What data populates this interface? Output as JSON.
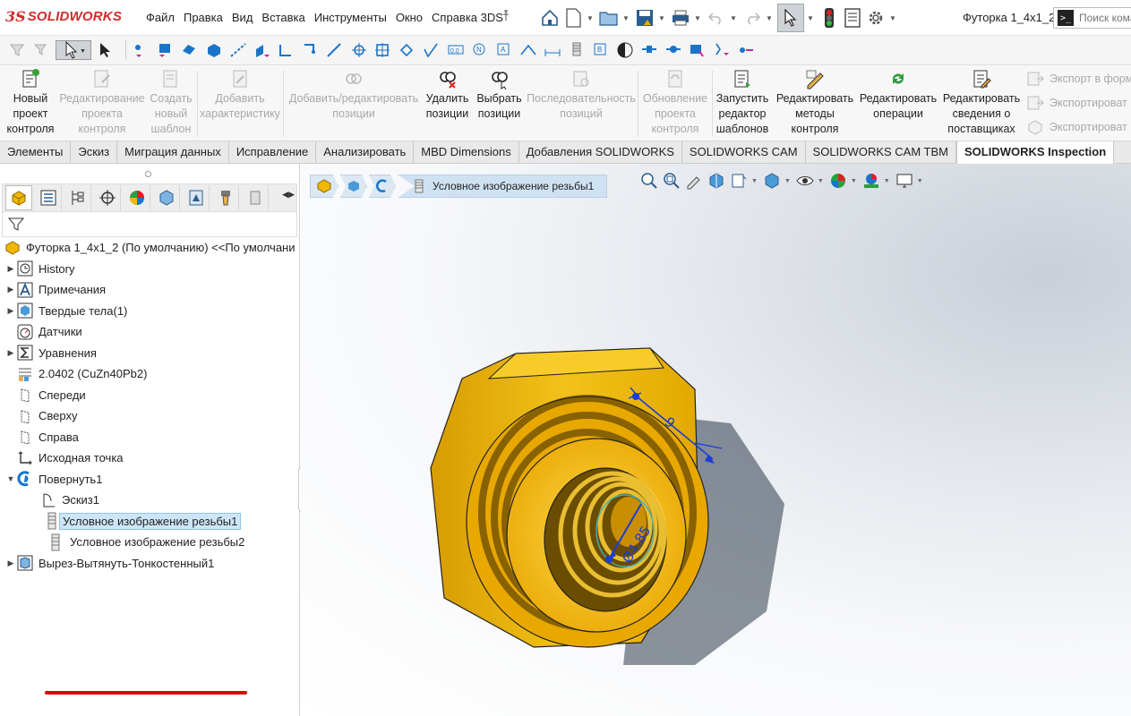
{
  "app": {
    "brand_mark": "3S",
    "brand_name": "SOLIDWORKS",
    "menu": [
      "Файл",
      "Правка",
      "Вид",
      "Вставка",
      "Инструменты",
      "Окно",
      "Справка 3DS"
    ],
    "document_title": "Футорка 1_4x1_2",
    "search_placeholder": "Поиск кома"
  },
  "commands": [
    {
      "label": "Новый\nпроект\nконтроля",
      "enabled": true
    },
    {
      "label": "Редактирование\nпроекта\nконтроля",
      "enabled": false
    },
    {
      "label": "Создать\nновый\nшаблон",
      "enabled": false
    },
    {
      "label": "Добавить\nхарактеристику",
      "enabled": false
    },
    {
      "label": "Добавить/редактировать\nпозиции",
      "enabled": false
    },
    {
      "label": "Удалить\nпозиции",
      "enabled": true
    },
    {
      "label": "Выбрать\nпозиции",
      "enabled": true
    },
    {
      "label": "Последовательность\nпозиций",
      "enabled": false
    },
    {
      "label": "Обновление\nпроекта\nконтроля",
      "enabled": false
    },
    {
      "label": "Запустить\nредактор\nшаблонов",
      "enabled": true
    },
    {
      "label": "Редактировать\nметоды\nконтроля",
      "enabled": true
    },
    {
      "label": "Редактировать\nоперации",
      "enabled": true
    },
    {
      "label": "Редактировать\nсведения о\nпоставщиках",
      "enabled": true
    }
  ],
  "export_items": [
    "Экспорт в форм",
    "Экспортироват",
    "Экспортироват"
  ],
  "tabs": [
    "Элементы",
    "Эскиз",
    "Миграция данных",
    "Исправление",
    "Анализировать",
    "MBD Dimensions",
    "Добавления SOLIDWORKS",
    "SOLIDWORKS CAM",
    "SOLIDWORKS CAM TBM",
    "SOLIDWORKS Inspection"
  ],
  "active_tab": "SOLIDWORKS Inspection",
  "tree": {
    "root": "Футорка 1_4x1_2 (По умолчанию) <<По умолчани",
    "nodes": [
      {
        "label": "History",
        "expander": true,
        "icon": "history-icon"
      },
      {
        "label": "Примечания",
        "expander": true,
        "icon": "annotations-icon"
      },
      {
        "label": "Твердые тела(1)",
        "expander": true,
        "icon": "solid-bodies-icon"
      },
      {
        "label": "Датчики",
        "expander": false,
        "icon": "sensors-icon"
      },
      {
        "label": "Уравнения",
        "expander": true,
        "icon": "equations-icon"
      },
      {
        "label": "2.0402 (CuZn40Pb2)",
        "expander": false,
        "icon": "material-icon"
      },
      {
        "label": "Спереди",
        "expander": false,
        "icon": "plane-icon"
      },
      {
        "label": "Сверху",
        "expander": false,
        "icon": "plane-icon"
      },
      {
        "label": "Справа",
        "expander": false,
        "icon": "plane-icon"
      },
      {
        "label": "Исходная точка",
        "expander": false,
        "icon": "origin-icon"
      },
      {
        "label": "Повернуть1",
        "expander": "open",
        "icon": "revolve-icon"
      },
      {
        "label": "Эскиз1",
        "expander": false,
        "icon": "sketch-icon",
        "indent": 1
      },
      {
        "label": "Условное изображение резьбы1",
        "expander": false,
        "icon": "cosmetic-thread-icon",
        "indent": 1,
        "selected": true
      },
      {
        "label": "Условное изображение резьбы2",
        "expander": false,
        "icon": "cosmetic-thread-icon",
        "indent": 1
      },
      {
        "label": "Вырез-Вытянуть-Тонкостенный1",
        "expander": true,
        "icon": "extrude-cut-icon"
      }
    ]
  },
  "breadcrumb": {
    "selected_feature": "Условное изображение резьбы1"
  },
  "model": {
    "dimension_thread": "Ø4.85",
    "dimension_length": "9"
  },
  "colors": {
    "accent": "#2b7fd0",
    "brand_red": "#d12c2c",
    "part_yellow": "#e6b800",
    "dimension_blue": "#1a3cd6",
    "highlight_red": "#e00000"
  }
}
